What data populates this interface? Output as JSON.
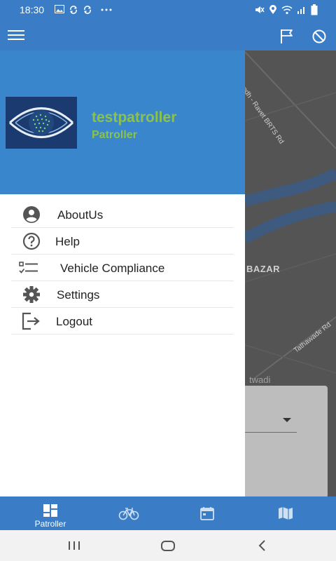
{
  "status_bar": {
    "time": "18:30",
    "left_icons": [
      "gallery-icon",
      "sync-icon",
      "sync-icon",
      "more-dots-icon"
    ],
    "right_icons": [
      "mute-icon",
      "location-icon",
      "wifi-icon",
      "signal-icon",
      "battery-icon"
    ]
  },
  "app_bar": {
    "icons": [
      "menu-icon",
      "flag-icon",
      "block-icon"
    ]
  },
  "drawer": {
    "user_name": "testpatroller",
    "user_role": "Patroller",
    "items": [
      {
        "label": "AboutUs",
        "icon": "account-circle-icon"
      },
      {
        "label": "Help",
        "icon": "help-circle-icon"
      },
      {
        "label": "Vehicle Compliance",
        "icon": "checklist-icon"
      },
      {
        "label": "Settings",
        "icon": "gear-icon"
      },
      {
        "label": "Logout",
        "icon": "logout-icon"
      }
    ]
  },
  "map": {
    "road_1": "Aundh - Ravet BRTS Rd",
    "road_2": "Tathawade Rd",
    "place_1": "BAZAR",
    "place_2": "twadi"
  },
  "bottom_nav": {
    "tabs": [
      {
        "label": "Patroller",
        "icon": "dashboard-icon",
        "active": true
      },
      {
        "label": "",
        "icon": "bicycle-icon",
        "active": false
      },
      {
        "label": "",
        "icon": "calendar-icon",
        "active": false
      },
      {
        "label": "",
        "icon": "map-icon",
        "active": false
      }
    ]
  },
  "colors": {
    "primary": "#3a7dc6",
    "drawer_header": "#3a86cc",
    "user_text": "#8bc34a",
    "map_bg": "#545454"
  }
}
